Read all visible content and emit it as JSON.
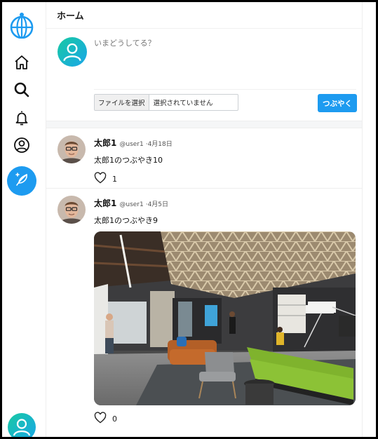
{
  "header": {
    "title": "ホーム"
  },
  "composer": {
    "placeholder": "いまどうしてる？",
    "file_button_label": "ファイルを選択",
    "file_status": "選択されていません",
    "submit_label": "つぶやく"
  },
  "posts": [
    {
      "name": "太郎1",
      "handle": "@user1",
      "date": "·4月18日",
      "text": "太郎1のつぶやき10",
      "likes": "1"
    },
    {
      "name": "太郎1",
      "handle": "@user1",
      "date": "·4月5日",
      "text": "太郎1のつぶやき9",
      "likes": "0"
    }
  ],
  "colors": {
    "accent": "#1d9bf0",
    "avatar_gradient_start": "#17c9a3",
    "avatar_gradient_end": "#1aa6e8"
  },
  "icons": {
    "logo": "globe-logo-icon",
    "home": "home-icon",
    "search": "search-icon",
    "notifications": "bell-icon",
    "profile": "user-circle-icon",
    "compose": "feather-icon",
    "like": "heart-icon"
  }
}
